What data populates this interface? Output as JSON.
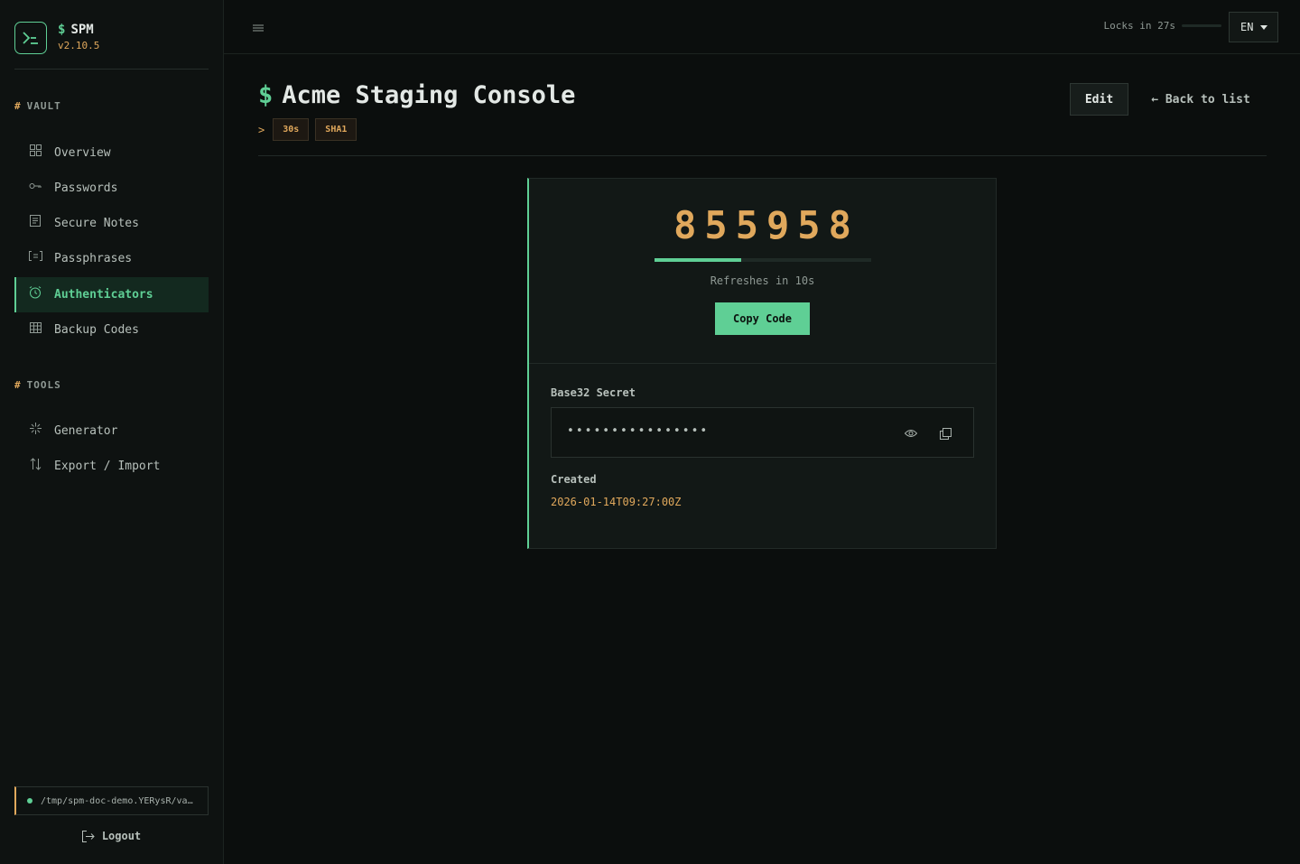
{
  "brand": {
    "name": "SPM",
    "prefix": "$",
    "version": "v2.10.5"
  },
  "sidebar": {
    "sections": [
      {
        "title": "VAULT",
        "hash": "#"
      },
      {
        "title": "TOOLS",
        "hash": "#"
      }
    ],
    "vault_items": [
      {
        "label": "Overview",
        "icon": "grid-icon"
      },
      {
        "label": "Passwords",
        "icon": "key-icon"
      },
      {
        "label": "Secure Notes",
        "icon": "note-icon"
      },
      {
        "label": "Passphrases",
        "icon": "bracket-equals-icon"
      },
      {
        "label": "Authenticators",
        "icon": "clock-icon",
        "active": true
      },
      {
        "label": "Backup Codes",
        "icon": "table-icon"
      }
    ],
    "tool_items": [
      {
        "label": "Generator",
        "icon": "sparkle-icon"
      },
      {
        "label": "Export / Import",
        "icon": "arrows-up-down-icon"
      }
    ],
    "vault_path": "/tmp/spm-doc-demo.YERysR/vault.db",
    "logout_label": "Logout"
  },
  "header": {
    "lock_text": "Locks in 27s",
    "language": "EN"
  },
  "main": {
    "title_prefix": "$",
    "title": "Acme Staging Console",
    "meta_prompt": ">",
    "badges": [
      "30s",
      "SHA1"
    ],
    "edit_label": "Edit",
    "back_label": "← Back to list"
  },
  "otp": {
    "code": "855958",
    "progress_fraction": 0.4,
    "refresh_text": "Refreshes in 10s",
    "copy_label": "Copy Code",
    "secret_label": "Base32 Secret",
    "secret_masked": "••••••••••••••••",
    "created_label": "Created",
    "created_value": "2026-01-14T09:27:00Z"
  },
  "colors": {
    "accent": "#5fcf95",
    "warning": "#e0a85c",
    "background": "#0b0e0d"
  }
}
